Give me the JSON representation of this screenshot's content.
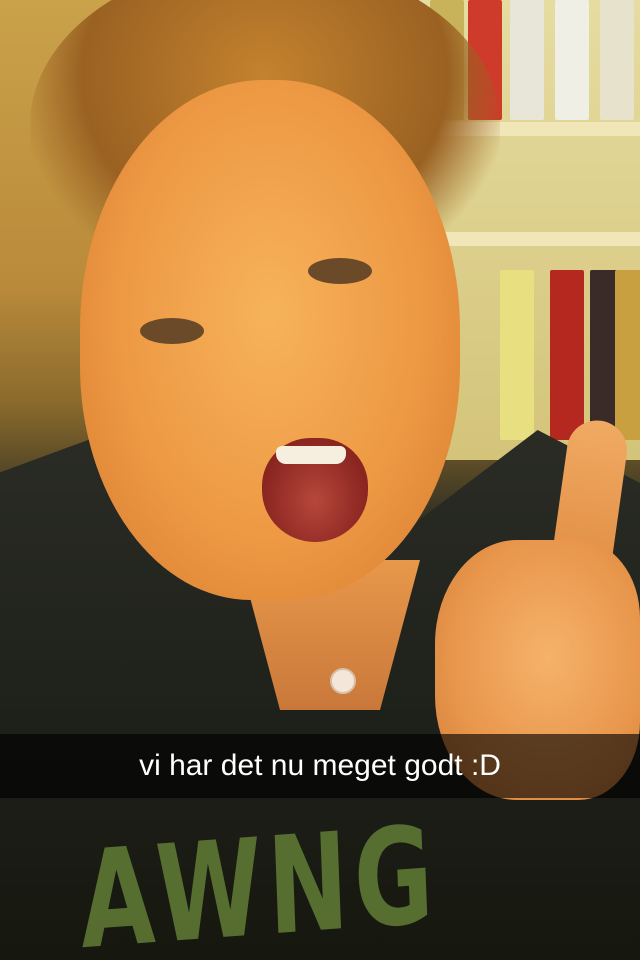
{
  "caption": {
    "text": "vi har det nu meget godt :D"
  },
  "photo": {
    "shirt_print_text": "AWNG"
  },
  "colors": {
    "caption_bar_background": "#000000",
    "caption_text": "#ffffff"
  }
}
